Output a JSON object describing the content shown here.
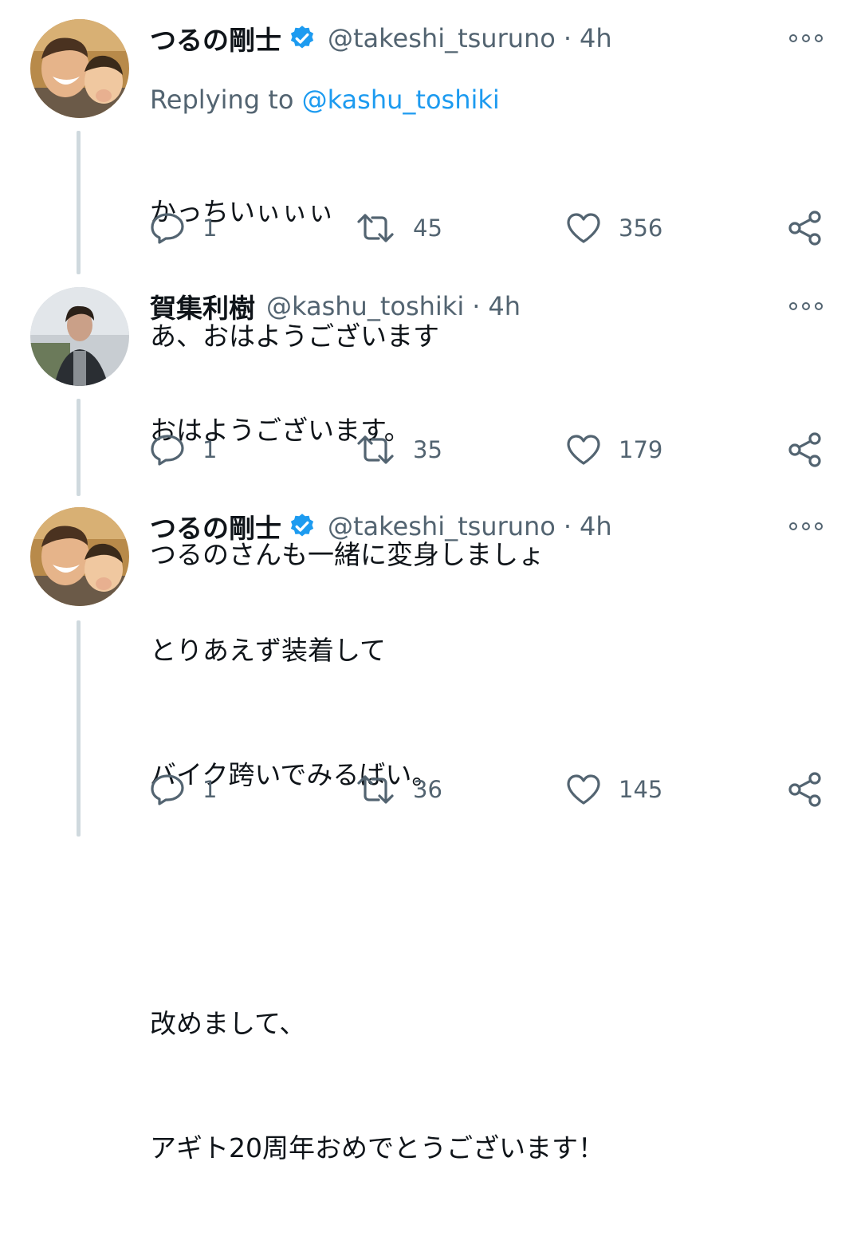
{
  "tweets": [
    {
      "name": "つるの剛士",
      "verified": true,
      "handle": "@takeshi_tsuruno",
      "time": "4h",
      "replying_label": "Replying to",
      "replying_to": "@kashu_toshiki",
      "lines": [
        "かっちいぃぃぃ",
        "あ、おはようございます"
      ],
      "replies": "1",
      "retweets": "45",
      "likes": "356"
    },
    {
      "name": "賀集利樹",
      "verified": false,
      "handle": "@kashu_toshiki",
      "time": "4h",
      "lines": [
        "おはようございます。",
        "つるのさんも一緒に変身しましょ"
      ],
      "replies": "1",
      "retweets": "35",
      "likes": "179"
    },
    {
      "name": "つるの剛士",
      "verified": true,
      "handle": "@takeshi_tsuruno",
      "time": "4h",
      "lines": [
        "とりあえず装着して",
        "バイク跨いでみるばい。",
        "",
        "改めまして、",
        "アギト20周年おめでとうございます！"
      ],
      "replies": "1",
      "retweets": "36",
      "likes": "145"
    }
  ],
  "separator": "·",
  "colors": {
    "accent": "#1d9bf0",
    "secondary_text": "#536471",
    "thread_line": "#cfd9de"
  },
  "icons": [
    "reply-icon",
    "retweet-icon",
    "like-icon",
    "share-icon",
    "more-icon",
    "verified-badge-icon"
  ]
}
